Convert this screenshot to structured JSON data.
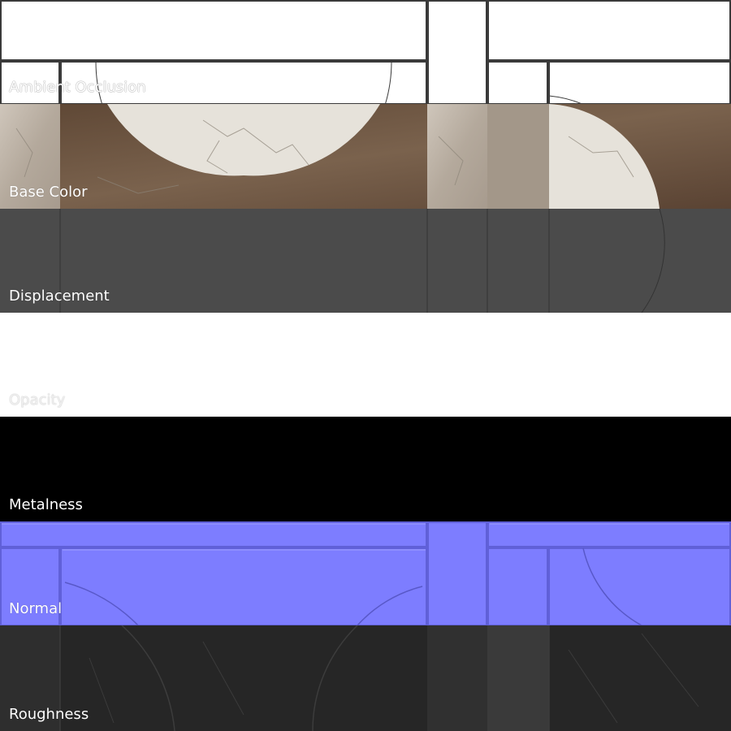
{
  "labels": {
    "ambient_occlusion": "Ambient Occlusion",
    "base_color": "Base Color",
    "displacement": "Displacement",
    "opacity": "Opacity",
    "metalness": "Metalness",
    "normal": "Normal",
    "roughness": "Roughness"
  },
  "colors": {
    "ambient_occlusion": "#ffffff",
    "base_brown": "#6e5743",
    "base_cream": "#e6e2da",
    "base_beige": "#b8ada1",
    "displacement": "#4b4b4b",
    "opacity": "#ffffff",
    "metalness": "#000000",
    "normal": "#7d7dff",
    "roughness": "#262626"
  }
}
